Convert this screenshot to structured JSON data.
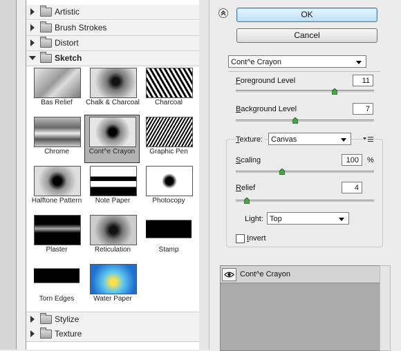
{
  "gallery": {
    "folders_top": [
      {
        "label": "Artistic",
        "open": false
      },
      {
        "label": "Brush Strokes",
        "open": false
      },
      {
        "label": "Distort",
        "open": false
      },
      {
        "label": "Sketch",
        "open": true
      }
    ],
    "folders_bottom": [
      {
        "label": "Stylize",
        "open": false
      },
      {
        "label": "Texture",
        "open": false
      }
    ],
    "thumbnails": [
      {
        "label": "Bas Relief"
      },
      {
        "label": "Chalk & Charcoal"
      },
      {
        "label": "Charcoal"
      },
      {
        "label": "Chrome"
      },
      {
        "label": "Cont^e Crayon",
        "selected": true
      },
      {
        "label": "Graphic Pen"
      },
      {
        "label": "Halftone Pattern"
      },
      {
        "label": "Note Paper"
      },
      {
        "label": "Photocopy"
      },
      {
        "label": "Plaster"
      },
      {
        "label": "Reticulation"
      },
      {
        "label": "Stamp"
      },
      {
        "label": "Torn Edges"
      },
      {
        "label": "Water Paper"
      }
    ]
  },
  "buttons": {
    "ok": "OK",
    "cancel": "Cancel"
  },
  "filter_select": {
    "value": "Cont^e Crayon"
  },
  "settings": {
    "foreground": {
      "label_u": "F",
      "label_rest": "oreground Level",
      "value": "11",
      "min": 1,
      "max": 15
    },
    "background": {
      "label_u": "B",
      "label_rest": "ackground Level",
      "value": "7",
      "min": 1,
      "max": 15
    },
    "texture": {
      "label_u": "T",
      "label_rest": "exture:",
      "value": "Canvas"
    },
    "scaling": {
      "label_u": "S",
      "label_rest": "caling",
      "value": "100",
      "unit": "%",
      "min": 50,
      "max": 200
    },
    "relief": {
      "label_u": "R",
      "label_rest": "elief",
      "value": "4",
      "min": 0,
      "max": 50
    },
    "light": {
      "label_pre": "Li",
      "label_u": "g",
      "label_rest": "ht:",
      "value": "Top"
    },
    "invert": {
      "label_u": "I",
      "label_rest": "nvert",
      "checked": false
    }
  },
  "layers": {
    "items": [
      {
        "label": "Cont^e Crayon",
        "visible": true
      }
    ]
  },
  "colors": {
    "accent": "#3c7fb1",
    "selected_thumb": "#b3b3b3",
    "layers_bg": "#ababab"
  }
}
